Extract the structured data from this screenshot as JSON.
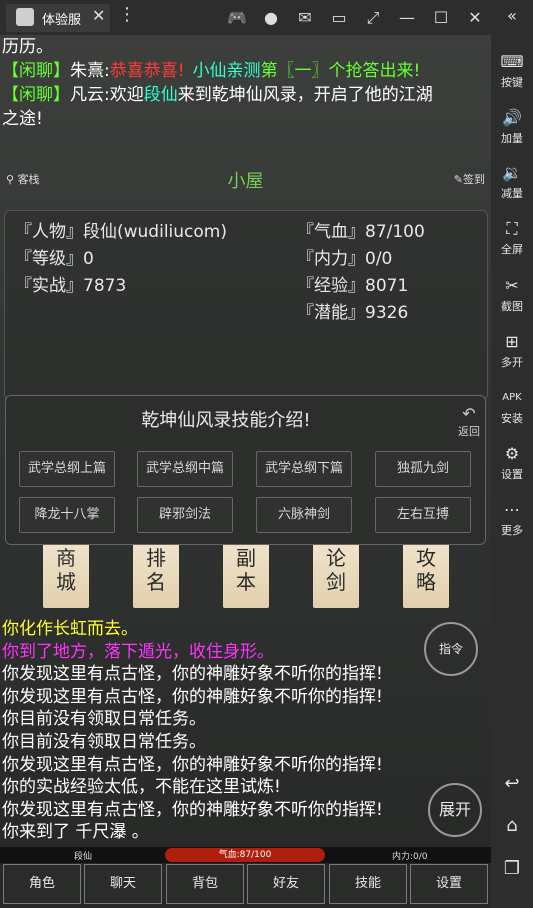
{
  "window": {
    "tab_title": "体验服"
  },
  "sidebar": {
    "items": [
      {
        "label": "按键",
        "icon": "keyboard-icon"
      },
      {
        "label": "加量",
        "icon": "volume-up-icon"
      },
      {
        "label": "减量",
        "icon": "volume-down-icon"
      },
      {
        "label": "全屏",
        "icon": "fullscreen-icon"
      },
      {
        "label": "截图",
        "icon": "scissors-icon"
      },
      {
        "label": "多开",
        "icon": "multi-open-icon"
      },
      {
        "label": "安装",
        "icon": "apk-icon"
      },
      {
        "label": "设置",
        "icon": "gear-icon"
      },
      {
        "label": "更多",
        "icon": "more-icon"
      }
    ]
  },
  "chat": {
    "line0": "历历。",
    "line1_tag": "【闲聊】",
    "line1_name": "朱熹:",
    "line1_msg_red": "恭喜恭喜!",
    "line1_msg_cyan": "小仙亲测",
    "line1_msg_green": "第〖一〗个抢答出来!",
    "line2_tag": "【闲聊】",
    "line2_name": "凡云:",
    "line2_msg_a": "欢迎",
    "line2_msg_name": "段仙",
    "line2_msg_b": "来到乾坤仙风录，开启了他的江湖",
    "line3": "之途!"
  },
  "room": {
    "title": "小屋",
    "left_corner": "客栈",
    "right_corner": "签到"
  },
  "stats": {
    "person": "『人物』段仙(wudiliucom)",
    "level": "『等级』0",
    "combat": "『实战』7873",
    "hp": "『气血』87/100",
    "mp": "『内力』0/0",
    "exp": "『经验』8071",
    "potential": "『潜能』9326"
  },
  "dialog": {
    "title": "乾坤仙风录技能介绍!",
    "back_label": "返回",
    "skills": [
      "武学总纲上篇",
      "武学总纲中篇",
      "武学总纲下篇",
      "独孤九剑",
      "降龙十八掌",
      "辟邪剑法",
      "六脉神剑",
      "左右互搏"
    ]
  },
  "scrolls": [
    "商城",
    "排名",
    "副本",
    "论剑",
    "攻略"
  ],
  "log": {
    "l0": "你化作长虹而去。",
    "l1": "你到了地方，落下遁光，收住身形。",
    "l2": "你发现这里有点古怪，你的神雕好象不听你的指挥!",
    "l3": "你发现这里有点古怪，你的神雕好象不听你的指挥!",
    "l4": "你目前没有领取日常任务。",
    "l5": "你目前没有领取日常任务。",
    "l6": "你发现这里有点古怪，你的神雕好象不听你的指挥!",
    "l7": "你的实战经验太低，不能在这里试炼!",
    "l8": "你发现这里有点古怪，你的神雕好象不听你的指挥!",
    "l9": "你来到了 千尺瀑 。"
  },
  "buttons": {
    "command": "指令",
    "expand": "展开"
  },
  "status": {
    "name": "段仙",
    "hp": "气血:87/100",
    "mp": "内力:0/0"
  },
  "nav": [
    "角色",
    "聊天",
    "背包",
    "好友",
    "技能",
    "设置"
  ]
}
